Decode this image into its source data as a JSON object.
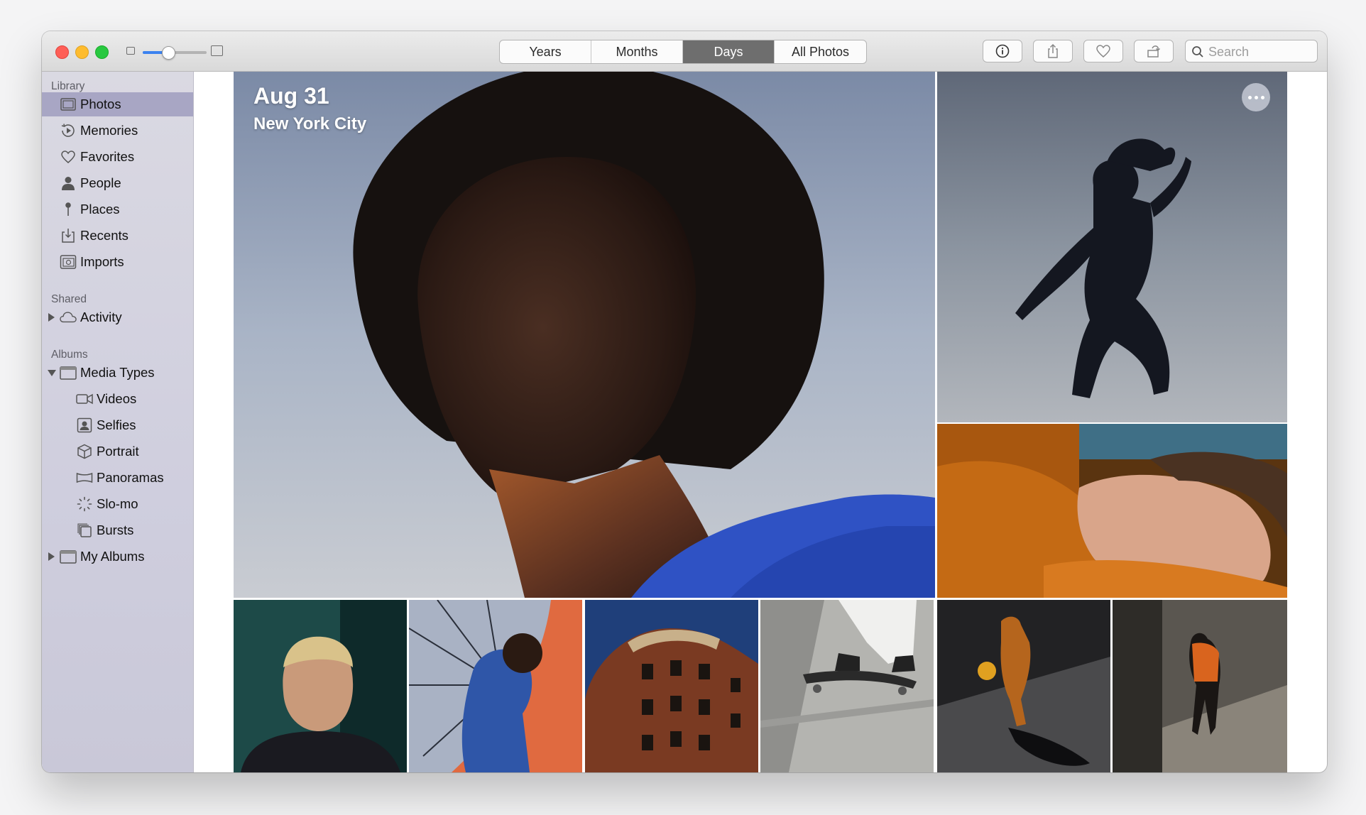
{
  "toolbar": {
    "views": [
      {
        "label": "Years",
        "active": false
      },
      {
        "label": "Months",
        "active": false
      },
      {
        "label": "Days",
        "active": true
      },
      {
        "label": "All Photos",
        "active": false
      }
    ],
    "zoom_level": 0.4,
    "buttons": [
      {
        "icon": "info-icon"
      },
      {
        "icon": "share-icon"
      },
      {
        "icon": "heart-icon"
      },
      {
        "icon": "rotate-icon"
      }
    ],
    "search": {
      "placeholder": "Search",
      "value": ""
    }
  },
  "sidebar": {
    "library": {
      "header": "Library",
      "items": [
        {
          "label": "Photos",
          "icon": "photos-icon",
          "selected": true
        },
        {
          "label": "Memories",
          "icon": "memories-icon"
        },
        {
          "label": "Favorites",
          "icon": "heart-icon"
        },
        {
          "label": "People",
          "icon": "person-icon"
        },
        {
          "label": "Places",
          "icon": "pin-icon"
        },
        {
          "label": "Recents",
          "icon": "recents-icon"
        },
        {
          "label": "Imports",
          "icon": "imports-icon"
        }
      ]
    },
    "shared": {
      "header": "Shared",
      "items": [
        {
          "label": "Activity",
          "icon": "cloud-icon",
          "collapsed": true
        }
      ]
    },
    "albums": {
      "header": "Albums",
      "media_types": {
        "label": "Media Types",
        "icon": "folder-icon",
        "expanded": true
      },
      "children": [
        {
          "label": "Videos",
          "icon": "video-icon"
        },
        {
          "label": "Selfies",
          "icon": "selfie-icon"
        },
        {
          "label": "Portrait",
          "icon": "portrait-cube-icon"
        },
        {
          "label": "Panoramas",
          "icon": "panorama-icon"
        },
        {
          "label": "Slo-mo",
          "icon": "slomo-icon"
        },
        {
          "label": "Bursts",
          "icon": "bursts-icon"
        }
      ],
      "my_albums": {
        "label": "My Albums",
        "icon": "folder-icon",
        "collapsed": true
      }
    }
  },
  "main": {
    "date": "Aug 31",
    "location": "New York City",
    "photos": [
      {
        "name": "portrait-closeup-photo"
      },
      {
        "name": "jumping-silhouette-photo"
      },
      {
        "name": "reclining-face-photo"
      },
      {
        "name": "teal-wall-portrait-photo"
      },
      {
        "name": "umbrella-hood-photo"
      },
      {
        "name": "brick-building-photo"
      },
      {
        "name": "skateboard-photo"
      },
      {
        "name": "basketball-photo"
      },
      {
        "name": "shadow-walk-photo"
      }
    ]
  }
}
